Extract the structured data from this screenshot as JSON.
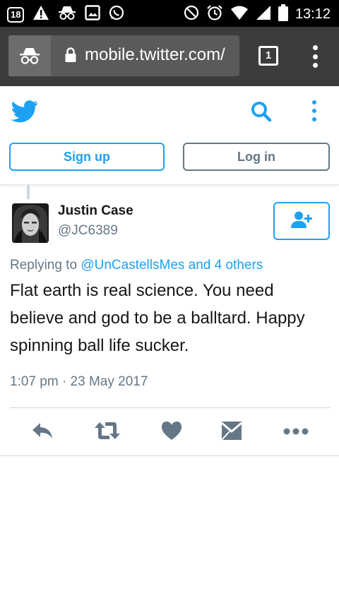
{
  "statusbar": {
    "notification_count": "18",
    "time": "13:12"
  },
  "browser": {
    "url": "mobile.twitter.com/",
    "tab_count": "1"
  },
  "header": {
    "signup_label": "Sign up",
    "login_label": "Log in"
  },
  "tweet": {
    "author_name": "Justin Case",
    "author_handle": "@JC6389",
    "replying_prefix": "Replying to",
    "replying_targets": "@UnCastellsMes and 4 others",
    "text": "Flat earth is real science. You need believe and god to be a balltard. Happy spinning ball life sucker.",
    "timestamp": "1:07 pm · 23 May 2017"
  },
  "colors": {
    "twitter_blue": "#1da1f2",
    "muted_gray": "#657786",
    "chrome_dark": "#3c3c3c"
  },
  "icons": {
    "status_left": [
      "notification-count-icon",
      "warning-icon",
      "incognito-icon",
      "image-icon",
      "whatsapp-icon"
    ],
    "status_right": [
      "do-not-disturb-icon",
      "alarm-icon",
      "wifi-icon",
      "signal-icon",
      "battery-icon"
    ],
    "actions": [
      "reply-icon",
      "retweet-icon",
      "like-icon",
      "direct-message-icon",
      "more-icon"
    ]
  }
}
